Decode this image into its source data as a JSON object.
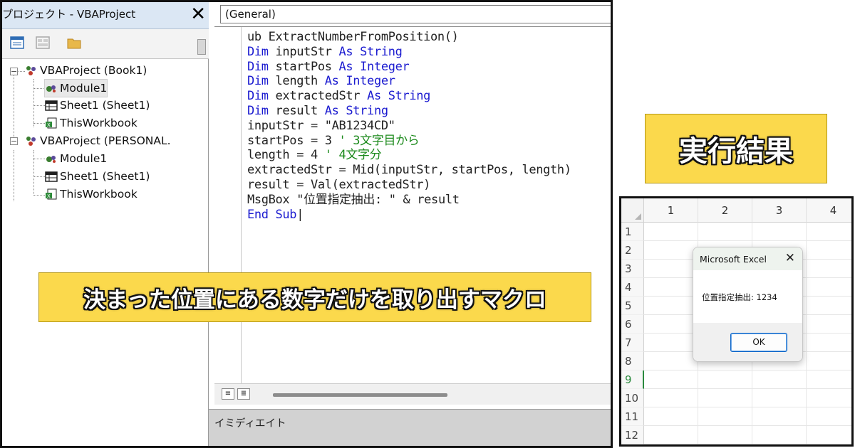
{
  "project_explorer": {
    "title": "プロジェクト - VBAProject",
    "close_glyph": "✕",
    "toolbar": [
      "view-code-icon",
      "view-object-icon",
      "toggle-folders-icon"
    ],
    "tree": [
      {
        "label": "VBAProject (Book1)",
        "expanded": true
      },
      {
        "label": "Module1",
        "selected": true
      },
      {
        "label": "Sheet1 (Sheet1)"
      },
      {
        "label": "ThisWorkbook"
      },
      {
        "label": "VBAProject (PERSONAL.",
        "expanded": true
      },
      {
        "label": "Module1"
      },
      {
        "label": "Sheet1 (Sheet1)"
      },
      {
        "label": "ThisWorkbook"
      }
    ]
  },
  "code_window": {
    "object_dropdown": "(General)",
    "lines": [
      [
        {
          "t": "ub ExtractNumberFromPosition()",
          "c": ""
        }
      ],
      [
        {
          "t": "Dim ",
          "c": "kw"
        },
        {
          "t": "inputStr ",
          "c": ""
        },
        {
          "t": "As String",
          "c": "kw"
        }
      ],
      [
        {
          "t": "Dim ",
          "c": "kw"
        },
        {
          "t": "startPos ",
          "c": ""
        },
        {
          "t": "As Integer",
          "c": "kw"
        }
      ],
      [
        {
          "t": "Dim ",
          "c": "kw"
        },
        {
          "t": "length ",
          "c": ""
        },
        {
          "t": "As Integer",
          "c": "kw"
        }
      ],
      [
        {
          "t": "Dim ",
          "c": "kw"
        },
        {
          "t": "extractedStr ",
          "c": ""
        },
        {
          "t": "As String",
          "c": "kw"
        }
      ],
      [
        {
          "t": "Dim ",
          "c": "kw"
        },
        {
          "t": "result ",
          "c": ""
        },
        {
          "t": "As String",
          "c": "kw"
        }
      ],
      [
        {
          "t": "inputStr = \"AB1234CD\"",
          "c": ""
        }
      ],
      [
        {
          "t": "startPos = 3 ",
          "c": ""
        },
        {
          "t": "' 3文字目から",
          "c": "cm"
        }
      ],
      [
        {
          "t": "length = 4 ",
          "c": ""
        },
        {
          "t": "' 4文字分",
          "c": "cm"
        }
      ],
      [
        {
          "t": "extractedStr = Mid(inputStr, startPos, length)",
          "c": ""
        }
      ],
      [
        {
          "t": "result = Val(extractedStr)",
          "c": ""
        }
      ],
      [
        {
          "t": "MsgBox \"位置指定抽出: \" & result",
          "c": ""
        }
      ],
      [
        {
          "t": "End Sub",
          "c": "kw"
        },
        {
          "t": "|",
          "c": ""
        }
      ]
    ],
    "view_buttons": [
      "≡",
      "≣"
    ]
  },
  "immediate_window": {
    "title": "イミディエイト"
  },
  "banner": {
    "text": "決まった位置にある数字だけを取り出すマクロ"
  },
  "result_label": {
    "text": "実行結果"
  },
  "excel": {
    "columns": [
      "1",
      "2",
      "3",
      "4"
    ],
    "rows": [
      "1",
      "2",
      "3",
      "4",
      "5",
      "6",
      "7",
      "8",
      "9",
      "10",
      "11",
      "12"
    ],
    "active_row": "9",
    "msgbox": {
      "title": "Microsoft Excel",
      "close_glyph": "✕",
      "message": "位置指定抽出: 1234",
      "ok_label": "OK"
    }
  },
  "colors": {
    "keyword": "#1b1bd0",
    "comment": "#1c8a1c",
    "banner_bg": "#fbd94c",
    "title_bar": "#dbe7f4"
  }
}
